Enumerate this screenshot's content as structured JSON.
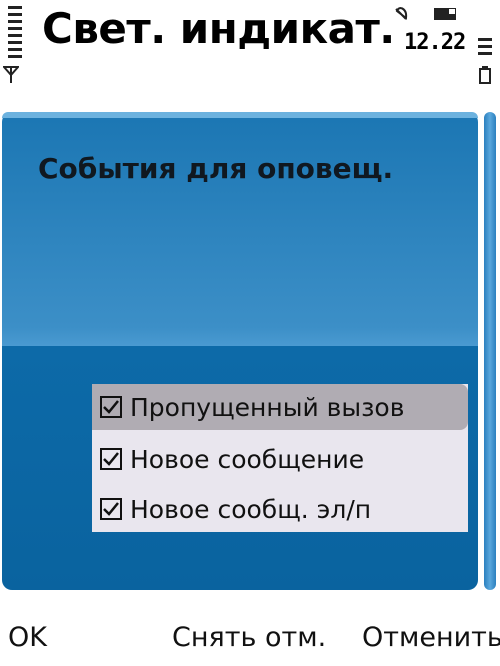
{
  "status_bar": {
    "title": "Свет. индикат.",
    "time": "12.22",
    "icons": [
      "signal-bars-icon",
      "antenna-icon",
      "alarm-icon",
      "memory-icon",
      "battery-bars-icon",
      "battery-icon"
    ]
  },
  "panel": {
    "heading": "События для оповещ."
  },
  "options": [
    {
      "label": "Пропущенный вызов",
      "checked": true,
      "highlighted": true
    },
    {
      "label": "Новое сообщение",
      "checked": true,
      "highlighted": false
    },
    {
      "label": "Новое сообщ. эл/п",
      "checked": true,
      "highlighted": false
    }
  ],
  "softkeys": {
    "left": "OK",
    "middle": "Снять отм.",
    "right": "Отменить"
  },
  "colors": {
    "panel_blue": "#1b76b3",
    "list_bg": "#e9e6ee",
    "highlight": "#b0acb3"
  }
}
